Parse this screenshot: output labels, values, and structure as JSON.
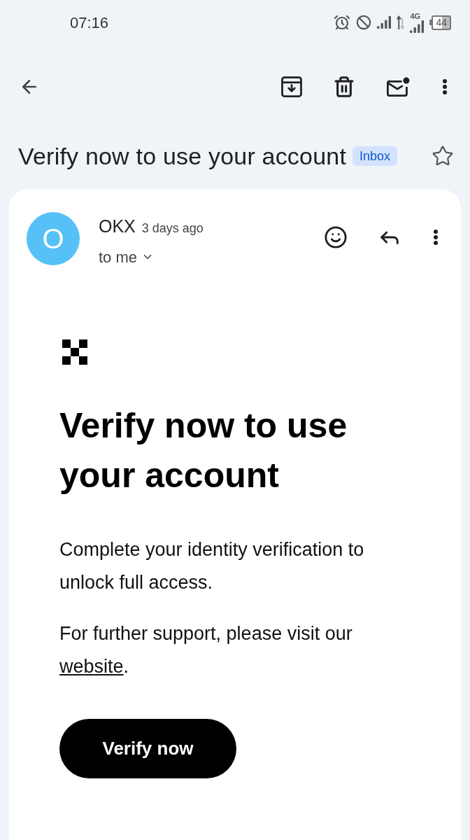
{
  "status_bar": {
    "time": "07:16",
    "network_label": "4G",
    "battery": "44"
  },
  "subject": {
    "title": "Verify now to use your account",
    "label": "Inbox",
    "starred": false
  },
  "message": {
    "avatar_letter": "O",
    "sender": "OKX",
    "time": "3 days ago",
    "recipient": "to me"
  },
  "body": {
    "heading": "Verify now to use your account",
    "paragraphs": [
      {
        "text": "Complete your identity verification to unlock full access."
      },
      {
        "text": "For further support, please visit our",
        "link": "website",
        "tail": "."
      }
    ],
    "button": "Verify now"
  }
}
